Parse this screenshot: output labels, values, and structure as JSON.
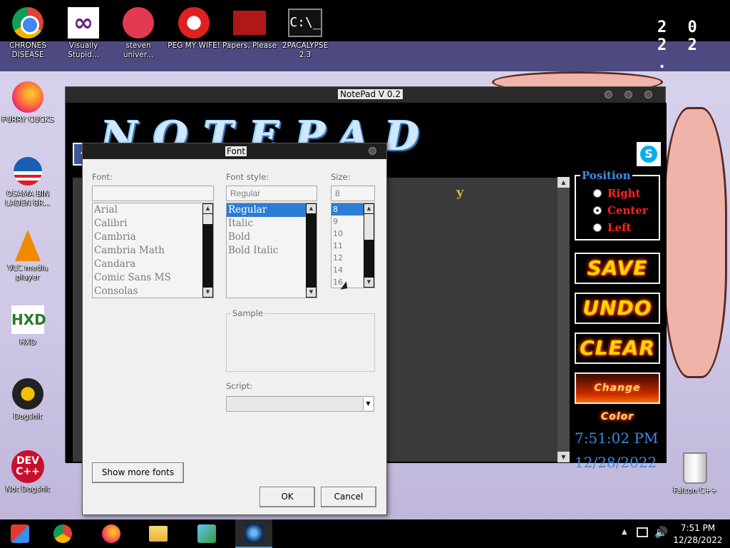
{
  "banner": {
    "year": "2 0 2 2 ."
  },
  "desktop_icons": [
    {
      "label": "CHRONES DISEASE"
    },
    {
      "label": "Visually Stupid..."
    },
    {
      "label": "steven univer..."
    },
    {
      "label": "PEG MY WIFE!"
    },
    {
      "label": "Papers, Please"
    },
    {
      "label": "2PACALYPSE 2.3"
    },
    {
      "label": "FURRY CUCKS"
    },
    {
      "label": "OSAMA BIN LADEN BR..."
    },
    {
      "label": "VLC media player"
    },
    {
      "label": "HXD"
    },
    {
      "label": "Dogshit"
    },
    {
      "label": "Not Dogshit"
    },
    {
      "label": "Falcon C++"
    }
  ],
  "notepad": {
    "title": "NotePad V 0.2",
    "logo_text": "NOTEPAD",
    "facebook_glyph": "f",
    "skype_glyph": "S",
    "text_fragment": "y",
    "position": {
      "legend": "Position",
      "options": [
        {
          "label": "Right",
          "selected": false
        },
        {
          "label": "Center",
          "selected": true
        },
        {
          "label": "Left",
          "selected": false
        }
      ]
    },
    "buttons": {
      "save": "SAVE",
      "undo": "UNDO",
      "clear": "CLEAR",
      "change_color": "Change Color"
    },
    "clock": {
      "time": "7:51:02 PM",
      "date": "12/28/2022"
    }
  },
  "font_dialog": {
    "title": "Font",
    "font_label": "Font:",
    "font_value": "",
    "fonts": [
      "Arial",
      "Calibri",
      "Cambria",
      "Cambria Math",
      "Candara",
      "Comic Sans MS",
      "Consolas"
    ],
    "style_label": "Font style:",
    "style_value": "Regular",
    "styles": [
      "Regular",
      "Italic",
      "Bold",
      "Bold Italic"
    ],
    "selected_style": "Regular",
    "size_label": "Size:",
    "size_value": "8",
    "sizes": [
      "8",
      "9",
      "10",
      "11",
      "12",
      "14",
      "16"
    ],
    "selected_size": "8",
    "sample_label": "Sample",
    "script_label": "Script:",
    "script_value": "",
    "show_more_fonts": "Show more fonts",
    "ok": "OK",
    "cancel": "Cancel"
  },
  "taskbar": {
    "time": "7:51 PM",
    "date": "12/28/2022"
  },
  "colors": {
    "accent_blue": "#2d7cd6",
    "position_blue": "#3c8ce8",
    "radio_red": "#ff2020",
    "fire_yellow": "#ffd400"
  }
}
